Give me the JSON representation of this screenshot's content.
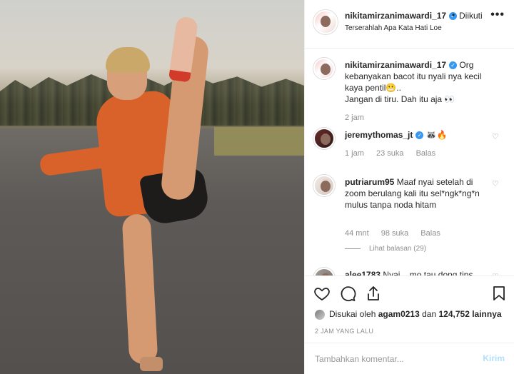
{
  "header": {
    "username": "nikitamirzanimawardi_17",
    "separator": "•",
    "follow_label": "Diikuti",
    "subtitle": "Terserahlah Apa Kata Hati Loe",
    "more": "•••"
  },
  "caption": {
    "username": "nikitamirzanimawardi_17",
    "text": "Org kebanyakan bacot itu nyali nya kecil kaya pentil😬..",
    "text2": "Jangan di tiru. Dah itu aja 👀",
    "time": "2 jam"
  },
  "comments": [
    {
      "username": "jeremythomas_jt",
      "text": "🦝🔥",
      "time": "1 jam",
      "likes": "23 suka",
      "reply": "Balas"
    },
    {
      "username": "putriarum95",
      "text": "Maaf nyai setelah di zoom berulang kali itu sel*ngk*ng*n mulus tanpa noda hitam",
      "time": "44 mnt",
      "likes": "98 suka",
      "reply": "Balas",
      "view_replies": "Lihat balasan (29)"
    },
    {
      "username": "alee1783",
      "text": "Nyai... mo tau dong tips"
    }
  ],
  "actions": {
    "liked_by_prefix": "Disukai oleh",
    "liked_by_user": "agam0213",
    "liked_by_joiner": "dan",
    "liked_by_count": "124,752 lainnya",
    "timestamp": "2 JAM YANG LALU"
  },
  "comment_box": {
    "placeholder": "Tambahkan komentar...",
    "send_label": "Kirim"
  }
}
